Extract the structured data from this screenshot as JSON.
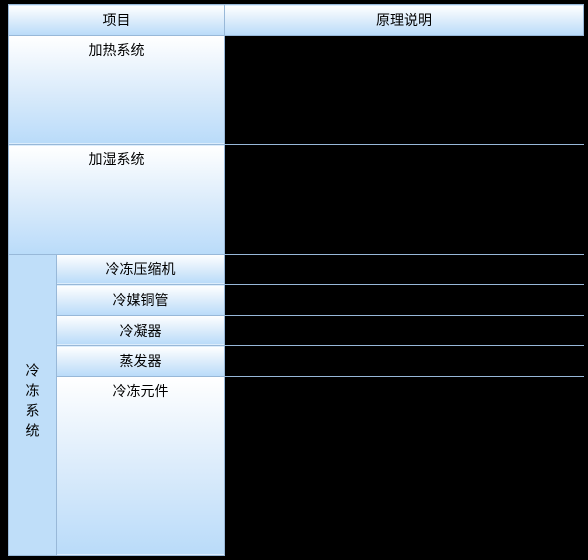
{
  "headers": {
    "item": "项目",
    "desc": "原理说明"
  },
  "rows": {
    "heating": {
      "label": "加热系统",
      "desc": ""
    },
    "humid": {
      "label": "加湿系统",
      "desc": ""
    },
    "cooling": {
      "group": "冷冻系统",
      "items": [
        {
          "label": "冷冻压缩机",
          "desc": ""
        },
        {
          "label": "冷媒铜管",
          "desc": ""
        },
        {
          "label": "冷凝器",
          "desc": ""
        },
        {
          "label": "蒸发器",
          "desc": ""
        },
        {
          "label": "冷冻元件",
          "desc": ""
        }
      ]
    }
  }
}
